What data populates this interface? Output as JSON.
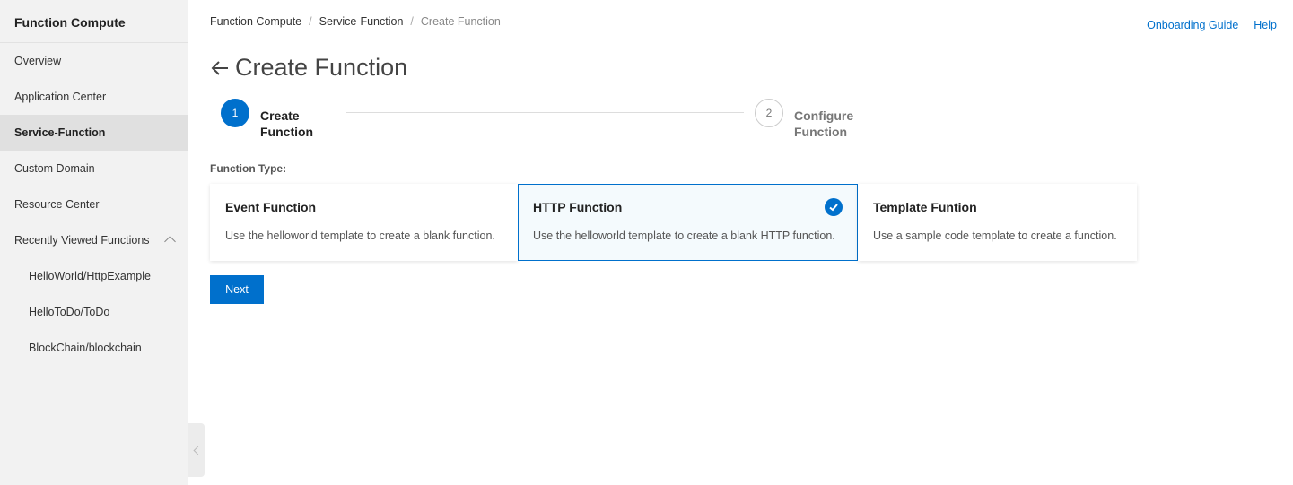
{
  "sidebar": {
    "title": "Function Compute",
    "items": [
      {
        "label": "Overview"
      },
      {
        "label": "Application Center"
      },
      {
        "label": "Service-Function"
      },
      {
        "label": "Custom Domain"
      },
      {
        "label": "Resource Center"
      }
    ],
    "recent_group": {
      "label": "Recently Viewed Functions",
      "items": [
        {
          "label": "HelloWorld/HttpExample"
        },
        {
          "label": "HelloToDo/ToDo"
        },
        {
          "label": "BlockChain/blockchain"
        }
      ]
    },
    "active_item": "Service-Function"
  },
  "breadcrumb": [
    "Function Compute",
    "Service-Function",
    "Create Function"
  ],
  "top_links": {
    "onboarding": "Onboarding Guide",
    "help": "Help"
  },
  "page_title": "Create Function",
  "steps": [
    {
      "number": "1",
      "label": "Create Function",
      "state": "active"
    },
    {
      "number": "2",
      "label": "Configure Function",
      "state": "inactive"
    }
  ],
  "function_type_label": "Function Type:",
  "cards": [
    {
      "title": "Event Function",
      "desc": "Use the helloworld template to create a blank function.",
      "selected": false
    },
    {
      "title": "HTTP Function",
      "desc": "Use the helloworld template to create a blank HTTP function.",
      "selected": true
    },
    {
      "title": "Template Funtion",
      "desc": "Use a sample code template to create a function.",
      "selected": false
    }
  ],
  "next_button": "Next",
  "colors": {
    "accent": "#0070cc",
    "sidebar_bg": "#f2f2f2"
  }
}
